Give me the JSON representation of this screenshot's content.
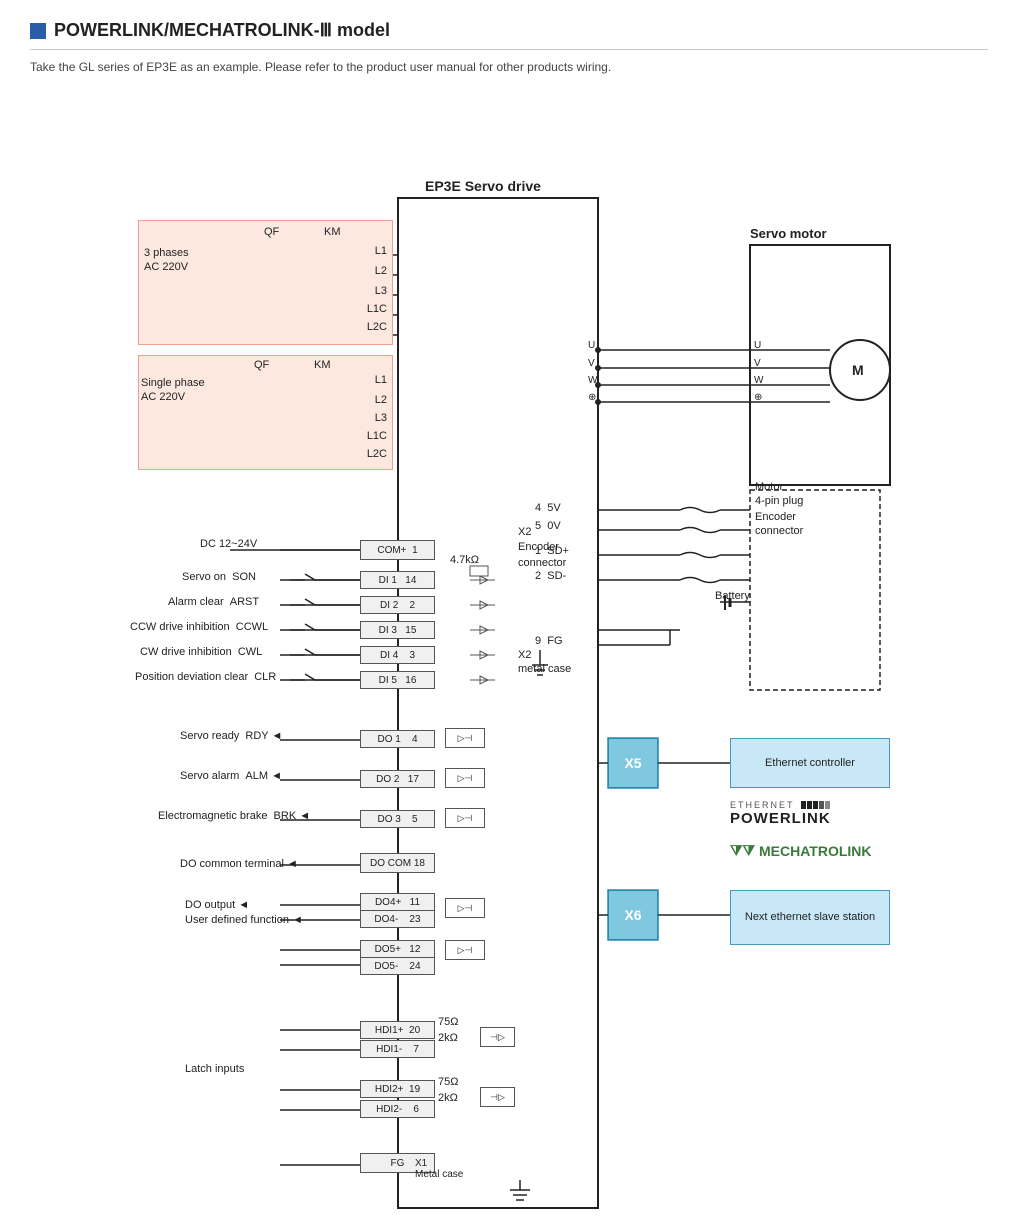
{
  "header": {
    "title": "POWERLINK/MECHATROLINK-Ⅲ model",
    "icon_label": "blue-square-icon"
  },
  "subtitle": "Take the GL series of EP3E as an example. Please refer to the product user manual for other products wiring.",
  "diagram": {
    "servo_drive_title": "EP3E Servo drive",
    "servo_motor_title": "Servo motor",
    "motor_plug_label": "Motor\n4-pin plug",
    "encoder_connector_label": "Encoder\nconnector",
    "x2_label": "X2\nEncoder\nconnector",
    "x2_metal_case": "X2\nmetal case",
    "x5_label": "X5",
    "x6_label": "X6",
    "ethernet_controller_label": "Ethernet controller",
    "next_ethernet_label": "Next ethernet\nslave station",
    "powerlink_label": "POWERLINK",
    "mechatrolink_label": "MECHATROLINK",
    "ethernet_text": "ETHERNET",
    "three_phase_label": "3 phases\nAC 220V",
    "single_phase_label": "Single phase\nAC 220V",
    "qf_label": "QF",
    "km_label": "KM",
    "dc_label": "DC\n12~24V",
    "resistance_4_7k": "4.7kΩ",
    "resistance_75_1": "75Ω",
    "resistance_2k_1": "2kΩ",
    "resistance_75_2": "75Ω",
    "resistance_2k_2": "2kΩ",
    "battery_label": "Battery",
    "terminals": [
      {
        "label": "L1",
        "pin": ""
      },
      {
        "label": "L2",
        "pin": ""
      },
      {
        "label": "L3",
        "pin": ""
      },
      {
        "label": "L1C",
        "pin": ""
      },
      {
        "label": "L2C",
        "pin": ""
      }
    ],
    "di_terminals": [
      {
        "name": "COM+",
        "pin": "1"
      },
      {
        "name": "DI 1",
        "pin": "14"
      },
      {
        "name": "DI 2",
        "pin": "2"
      },
      {
        "name": "DI 3",
        "pin": "15"
      },
      {
        "name": "DI 4",
        "pin": "3"
      },
      {
        "name": "DI 5",
        "pin": "16"
      }
    ],
    "di_labels": [
      {
        "signal": "Servo on",
        "abbr": "SON"
      },
      {
        "signal": "Alarm clear",
        "abbr": "ARST"
      },
      {
        "signal": "CCW drive inhibition",
        "abbr": "CCWL"
      },
      {
        "signal": "CW drive inhibition",
        "abbr": "CWL"
      },
      {
        "signal": "Position deviation clear",
        "abbr": "CLR"
      }
    ],
    "do_terminals": [
      {
        "name": "DO 1",
        "pin": "4"
      },
      {
        "name": "DO 2",
        "pin": "17"
      },
      {
        "name": "DO 3",
        "pin": "5"
      },
      {
        "name": "DO\nCOM",
        "pin": "18"
      },
      {
        "name": "DO4+",
        "pin": "11"
      },
      {
        "name": "DO4-",
        "pin": "23"
      },
      {
        "name": "DO5+",
        "pin": "12"
      },
      {
        "name": "DO5-",
        "pin": "24"
      }
    ],
    "do_labels": [
      {
        "signal": "Servo ready",
        "abbr": "RDY"
      },
      {
        "signal": "Servo alarm",
        "abbr": "ALM"
      },
      {
        "signal": "Electromagnetic brake",
        "abbr": "BRK"
      },
      {
        "signal": "DO common terminal",
        "abbr": ""
      },
      {
        "signal": "DO output\nUser defined function",
        "abbr": ""
      }
    ],
    "hdi_terminals": [
      {
        "name": "HDI1+",
        "pin": "20"
      },
      {
        "name": "HDI1-",
        "pin": "7"
      },
      {
        "name": "HDI2+",
        "pin": "19"
      },
      {
        "name": "HDI2-",
        "pin": "6"
      }
    ],
    "hdi_label": "Latch inputs",
    "fg_label": "FG",
    "x1_label": "X1\nMetal case",
    "encoder_pins": [
      {
        "pin": "4",
        "sig": "5V"
      },
      {
        "pin": "5",
        "sig": "0V"
      },
      {
        "pin": "1",
        "sig": "SD+"
      },
      {
        "pin": "2",
        "sig": "SD-"
      },
      {
        "pin": "9",
        "sig": "FG"
      }
    ],
    "uvw_labels": [
      "U",
      "V",
      "W",
      "⊕"
    ]
  }
}
